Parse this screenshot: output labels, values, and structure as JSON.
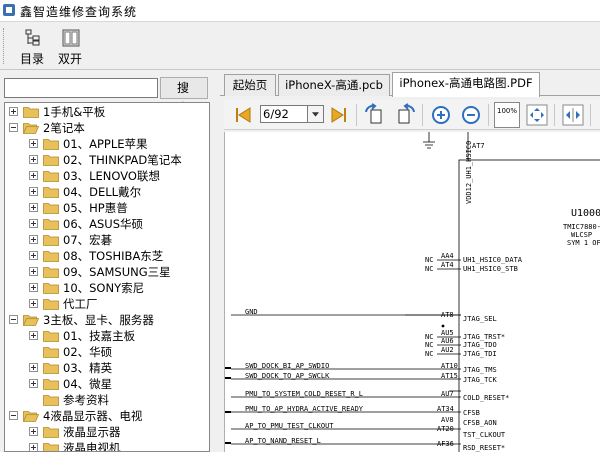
{
  "window": {
    "title": "鑫智造维修查询系统"
  },
  "toolbar": {
    "catalog_label": "目录",
    "dual_label": "双开"
  },
  "search": {
    "value": "",
    "button_label": "搜索"
  },
  "tree": [
    {
      "label": "1手机&平板",
      "level": 0,
      "expander": "plus",
      "open": false
    },
    {
      "label": "2笔记本",
      "level": 0,
      "expander": "minus",
      "open": true
    },
    {
      "label": "01、APPLE苹果",
      "level": 1,
      "expander": "plus",
      "open": false
    },
    {
      "label": "02、THINKPAD笔记本",
      "level": 1,
      "expander": "plus",
      "open": false
    },
    {
      "label": "03、LENOVO联想",
      "level": 1,
      "expander": "plus",
      "open": false
    },
    {
      "label": "04、DELL戴尔",
      "level": 1,
      "expander": "plus",
      "open": false
    },
    {
      "label": "05、HP惠普",
      "level": 1,
      "expander": "plus",
      "open": false
    },
    {
      "label": "06、ASUS华硕",
      "level": 1,
      "expander": "plus",
      "open": false
    },
    {
      "label": "07、宏碁",
      "level": 1,
      "expander": "plus",
      "open": false
    },
    {
      "label": "08、TOSHIBA东芝",
      "level": 1,
      "expander": "plus",
      "open": false
    },
    {
      "label": "09、SAMSUNG三星",
      "level": 1,
      "expander": "plus",
      "open": false
    },
    {
      "label": "10、SONY索尼",
      "level": 1,
      "expander": "plus",
      "open": false
    },
    {
      "label": "代工厂",
      "level": 1,
      "expander": "plus",
      "open": false
    },
    {
      "label": "3主板、显卡、服务器",
      "level": 0,
      "expander": "minus",
      "open": true
    },
    {
      "label": "01、技嘉主板",
      "level": 1,
      "expander": "plus",
      "open": false
    },
    {
      "label": "02、华硕",
      "level": 1,
      "expander": "none",
      "open": false
    },
    {
      "label": "03、精英",
      "level": 1,
      "expander": "plus",
      "open": false
    },
    {
      "label": "04、微星",
      "level": 1,
      "expander": "plus",
      "open": false
    },
    {
      "label": "参考资料",
      "level": 1,
      "expander": "none",
      "open": false
    },
    {
      "label": "4液晶显示器、电视",
      "level": 0,
      "expander": "minus",
      "open": true
    },
    {
      "label": "液晶显示器",
      "level": 1,
      "expander": "plus",
      "open": false
    },
    {
      "label": "液晶电视机",
      "level": 1,
      "expander": "plus",
      "open": false
    }
  ],
  "tabs": [
    {
      "label": "起始页",
      "active": false
    },
    {
      "label": "iPhoneX-高通.pcb",
      "active": false
    },
    {
      "label": "iPhonex-高通电路图.PDF",
      "active": true
    }
  ],
  "pdf": {
    "page_value": "6/92",
    "fit_label": "100%",
    "schematic": {
      "top_pin": "AT7",
      "vdd_label": "VDD12_UH1_HSIC0",
      "chip_label": "U1000",
      "chip_sub": "TMIC7880-",
      "chip_sub2": "WLCSP",
      "chip_sub3": "SYM 1 OF",
      "left_signals": [
        {
          "name": "GND",
          "pin": "AT8",
          "right": "JTAG_SEL"
        },
        {
          "name": "SWD_DOCK_BI_AP_SWDIO",
          "pin": "AT10",
          "right": "JTAG_TMS"
        },
        {
          "name": "SWD_DOCK_TO_AP_SWCLK",
          "pin": "AT15",
          "right": "JTAG_TCK"
        },
        {
          "name": "PMU_TO_SYSTEM_COLD_RESET_R_L",
          "pin": "AU7",
          "right": "COLD_RESET*"
        },
        {
          "name": "PMU_TO_AP_HYDRA_ACTIVE_READY",
          "pin": "AT34",
          "right": "CFSB"
        },
        {
          "name": "AP_TO_PMU_TEST_CLKOUT",
          "pin": "AT20",
          "right": "TST_CLKOUT"
        },
        {
          "name": "AP_TO_NAND_RESET_L",
          "pin": "AF36",
          "right": "RSD_RESET*"
        }
      ],
      "nc_pins": [
        {
          "nc": "NC",
          "pin": "AA4",
          "right": "UH1_HSIC0_DATA"
        },
        {
          "nc": "NC",
          "pin": "AT4",
          "right": "UH1_HSIC0_STB"
        },
        {
          "nc": "NC",
          "pin": "AU5",
          "right": "JTAG_TRST*"
        },
        {
          "nc": "NC",
          "pin": "AU6",
          "right": "JTAG_TDO"
        },
        {
          "nc": "NC",
          "pin": "AU2",
          "right": "JTAG_TDI"
        }
      ],
      "misc_pins": [
        {
          "pin": "AV8",
          "right": "CFSB_AON"
        }
      ]
    }
  },
  "colors": {
    "accent_blue": "#2f6fc0",
    "folder": "#e8c15a",
    "nav_gold": "#e0a020"
  }
}
